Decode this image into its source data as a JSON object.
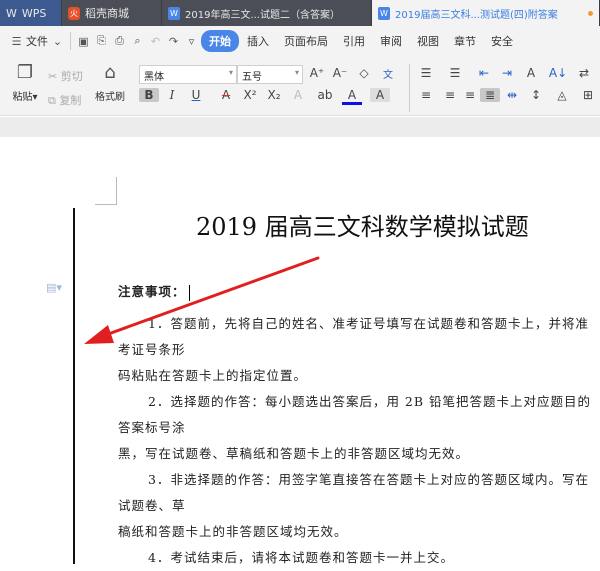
{
  "tabs": [
    {
      "label": "WPS"
    },
    {
      "label": "稻壳商城"
    },
    {
      "label": "2019年高三文...试题二（含答案）"
    },
    {
      "label": "2019届高三文科...测试题(四)附答案"
    }
  ],
  "menu": {
    "file": "文件",
    "items": [
      "开始",
      "插入",
      "页面布局",
      "引用",
      "审阅",
      "视图",
      "章节",
      "安全"
    ]
  },
  "ribbon": {
    "paste": "粘贴",
    "cut": "剪切",
    "copy": "复制",
    "format_painter": "格式刷",
    "font": "黑体",
    "size": "五号"
  },
  "doc": {
    "title": "2019 届高三文科数学模拟试题",
    "notice": "注意事项：",
    "lines": [
      "1．答题前，先将自己的姓名、准考证号填写在试题卷和答题卡上，并将准考证号条形",
      "码粘贴在答题卡上的指定位置。",
      "2．选择题的作答：每小题选出答案后，用 2B 铅笔把答题卡上对应题目的答案标号涂",
      "黑，写在试题卷、草稿纸和答题卡上的非答题区域均无效。",
      "3．非选择题的作答：用签字笔直接答在答题卡上对应的答题区域内。写在试题卷、草",
      "稿纸和答题卡上的非答题区域均无效。",
      "4．考试结束后，请将本试题卷和答题卡一并上交。"
    ]
  },
  "colors": {
    "accent": "#4a86e8",
    "arrow": "#e02020"
  }
}
